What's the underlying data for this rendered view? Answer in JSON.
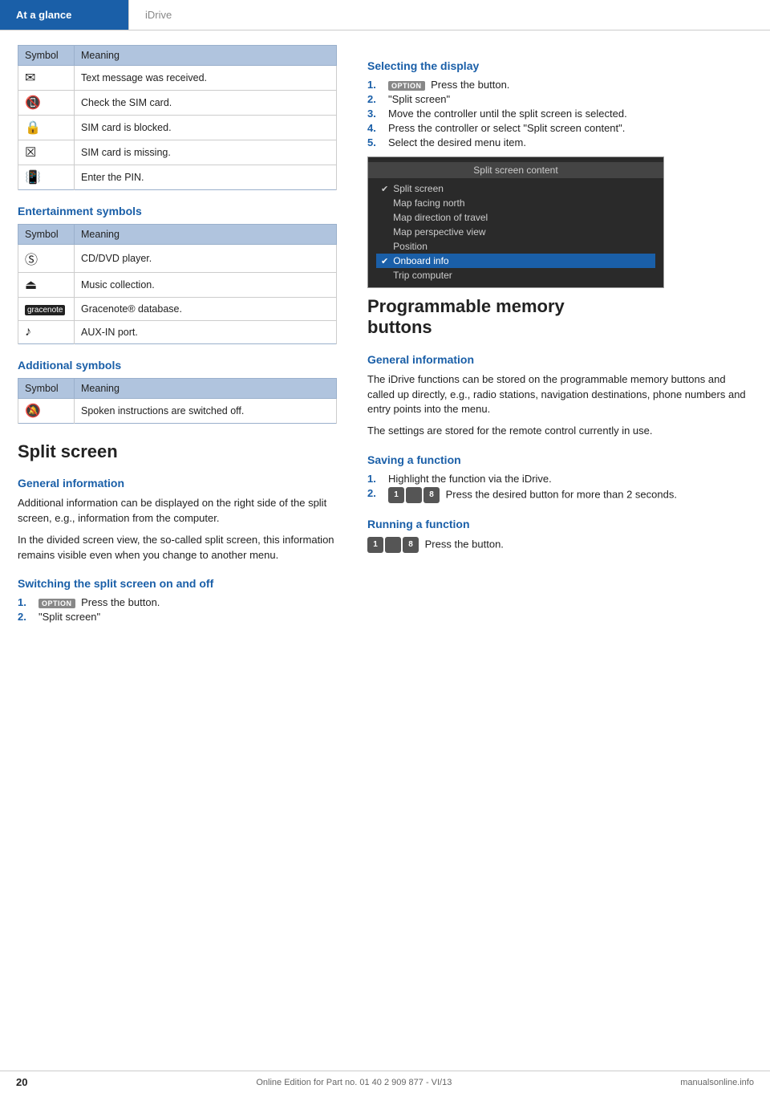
{
  "header": {
    "left_label": "At a glance",
    "right_label": "iDrive"
  },
  "left_col": {
    "phone_table": {
      "col1": "Symbol",
      "col2": "Meaning",
      "rows": [
        {
          "symbol": "✉",
          "meaning": "Text message was received."
        },
        {
          "symbol": "📵",
          "meaning": "Check the SIM card."
        },
        {
          "symbol": "🔒",
          "meaning": "SIM card is blocked."
        },
        {
          "symbol": "✘",
          "meaning": "SIM card is missing."
        },
        {
          "symbol": "🔑",
          "meaning": "Enter the PIN."
        }
      ]
    },
    "entertainment_heading": "Entertainment symbols",
    "entertainment_table": {
      "col1": "Symbol",
      "col2": "Meaning",
      "rows": [
        {
          "symbol": "⊙",
          "meaning": "CD/DVD player."
        },
        {
          "symbol": "▲",
          "meaning": "Music collection."
        },
        {
          "symbol": "G",
          "meaning": "Gracenote® database."
        },
        {
          "symbol": "♪",
          "meaning": "AUX-IN port."
        }
      ]
    },
    "additional_heading": "Additional symbols",
    "additional_table": {
      "col1": "Symbol",
      "col2": "Meaning",
      "rows": [
        {
          "symbol": "🔕",
          "meaning": "Spoken instructions are switched off."
        }
      ]
    },
    "split_screen_heading": "Split screen",
    "split_general_heading": "General information",
    "split_general_text1": "Additional information can be displayed on the right side of the split screen, e.g., information from the computer.",
    "split_general_text2": "In the divided screen view, the so-called split screen, this information remains visible even when you change to another menu.",
    "switching_heading": "Switching the split screen on and off",
    "switching_steps": [
      {
        "num": "1.",
        "text": "Press the button.",
        "has_icon": true
      },
      {
        "num": "2.",
        "text": "\"Split screen\""
      }
    ]
  },
  "right_col": {
    "selecting_heading": "Selecting the display",
    "selecting_steps": [
      {
        "num": "1.",
        "text": "Press the button.",
        "has_icon": true
      },
      {
        "num": "2.",
        "text": "\"Split screen\""
      },
      {
        "num": "3.",
        "text": "Move the controller until the split screen is selected."
      },
      {
        "num": "4.",
        "text": "Press the controller or select \"Split screen content\"."
      },
      {
        "num": "5.",
        "text": "Select the desired menu item."
      }
    ],
    "screenshot": {
      "title": "Split screen content",
      "items": [
        {
          "label": "✔ Split screen",
          "checked": false
        },
        {
          "label": "Map facing north",
          "checked": false
        },
        {
          "label": "Map direction of travel",
          "checked": false
        },
        {
          "label": "Map perspective view",
          "checked": false
        },
        {
          "label": "Position",
          "checked": false
        },
        {
          "label": "Onboard info",
          "checked": true
        },
        {
          "label": "Trip computer",
          "checked": false
        }
      ]
    },
    "prog_memory_heading": "Programmable memory\nbuttons",
    "prog_general_heading": "General information",
    "prog_general_text1": "The iDrive functions can be stored on the programmable memory buttons and called up directly, e.g., radio stations, navigation destinations, phone numbers and entry points into the menu.",
    "prog_general_text2": "The settings are stored for the remote control currently in use.",
    "saving_heading": "Saving a function",
    "saving_steps": [
      {
        "num": "1.",
        "text": "Highlight the function via the iDrive."
      },
      {
        "num": "2.",
        "text": "Press the desired button for more than 2 seconds.",
        "has_icon": true
      }
    ],
    "running_heading": "Running a function",
    "running_text": "Press the button.",
    "running_has_icon": true
  },
  "footer": {
    "page_number": "20",
    "edition_text": "Online Edition for Part no. 01 40 2 909 877 - VI/13",
    "brand": "manualsonline.info"
  }
}
